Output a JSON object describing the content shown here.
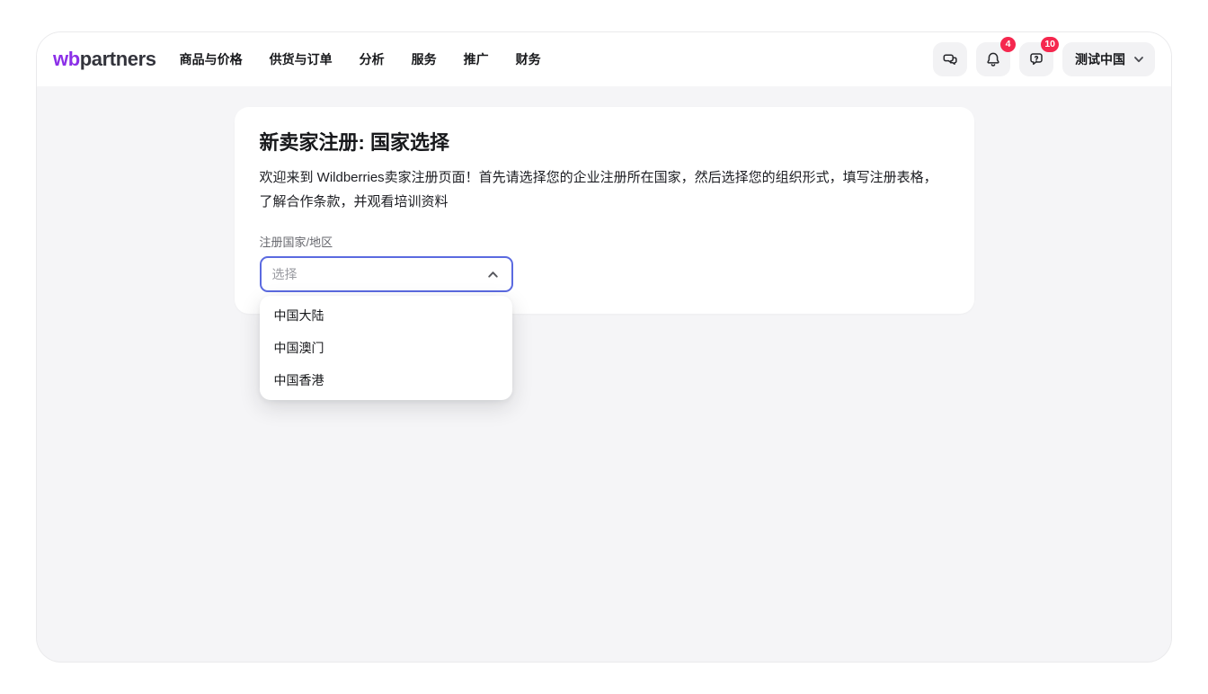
{
  "header": {
    "logo": {
      "wb": "wb",
      "partners": "partners"
    },
    "nav": [
      "商品与价格",
      "供货与订单",
      "分析",
      "服务",
      "推广",
      "财务"
    ],
    "actions": {
      "notifications_badge": "4",
      "help_badge": "10",
      "account_label": "测试中国"
    }
  },
  "main": {
    "card": {
      "title": "新卖家注册: 国家选择",
      "description": "欢迎来到 Wildberries卖家注册页面！首先请选择您的企业注册所在国家，然后选择您的组织形式，填写注册表格，了解合作条款，并观看培训资料",
      "field_label": "注册国家/地区",
      "select_placeholder": "选择"
    },
    "dropdown_options": [
      "中国大陆",
      "中国澳门",
      "中国香港"
    ]
  },
  "icons": {
    "chat": "chat-bubbles-icon",
    "notifications": "bell-icon",
    "help": "help-bubble-icon",
    "account": "chevron-down-icon",
    "select_state": "chevron-up-icon"
  },
  "colors": {
    "brand_purple": "#8b2fe8",
    "logo_text": "#33343c",
    "select_focus_border": "#5b6ae0",
    "badge_red": "#f5274e",
    "content_background": "#f5f5f7",
    "header_background": "#ffffff"
  }
}
